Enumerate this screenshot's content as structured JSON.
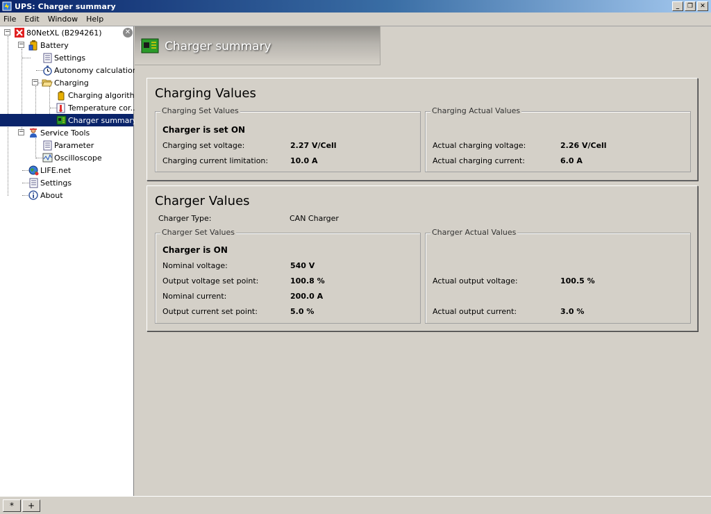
{
  "window": {
    "title": "UPS: Charger summary",
    "minimize_glyph": "_",
    "restore_glyph": "❐",
    "close_glyph": "✕"
  },
  "menu": [
    "File",
    "Edit",
    "Window",
    "Help"
  ],
  "tree": {
    "close_glyph": "✕",
    "items": [
      {
        "label": "80NetXL (B294261)",
        "icon": "ups-error-icon"
      },
      {
        "label": "Battery",
        "icon": "battery-icon"
      },
      {
        "label": "Settings",
        "icon": "settings-page-icon"
      },
      {
        "label": "Autonomy calculation",
        "icon": "stopwatch-icon"
      },
      {
        "label": "Charging",
        "icon": "folder-open-icon"
      },
      {
        "label": "Charging algorithm",
        "icon": "battery-small-icon"
      },
      {
        "label": "Temperature cor...",
        "icon": "thermometer-page-icon"
      },
      {
        "label": "Charger summary",
        "icon": "charger-board-icon"
      },
      {
        "label": "Service Tools",
        "icon": "service-person-icon"
      },
      {
        "label": "Parameter",
        "icon": "parameter-page-icon"
      },
      {
        "label": "Oscilloscope",
        "icon": "oscilloscope-icon"
      },
      {
        "label": "LIFE.net",
        "icon": "globe-icon"
      },
      {
        "label": "Settings",
        "icon": "settings-page-icon"
      },
      {
        "label": "About",
        "icon": "info-icon"
      }
    ]
  },
  "header": {
    "title": "Charger summary",
    "icon": "charger-board-icon"
  },
  "charging_values": {
    "title": "Charging Values",
    "set": {
      "legend": "Charging Set Values",
      "status": "Charger is set ON",
      "voltage_label": "Charging set voltage:",
      "voltage_value": "2.27 V/Cell",
      "current_label": "Charging current limitation:",
      "current_value": "10.0 A"
    },
    "actual": {
      "legend": "Charging Actual Values",
      "voltage_label": "Actual charging voltage:",
      "voltage_value": "2.26 V/Cell",
      "current_label": "Actual charging current:",
      "current_value": "6.0 A"
    }
  },
  "charger_values": {
    "title": "Charger Values",
    "type_label": "Charger Type:",
    "type_value": "CAN Charger",
    "set": {
      "legend": "Charger Set Values",
      "status": "Charger is ON",
      "nominal_voltage_label": "Nominal voltage:",
      "nominal_voltage_value": "540 V",
      "output_voltage_label": "Output voltage set point:",
      "output_voltage_value": "100.8 %",
      "nominal_current_label": "Nominal current:",
      "nominal_current_value": "200.0 A",
      "output_current_label": "Output current set point:",
      "output_current_value": "5.0 %"
    },
    "actual": {
      "legend": "Charger Actual Values",
      "output_voltage_label": "Actual output voltage:",
      "output_voltage_value": "100.5 %",
      "output_current_label": "Actual output current:",
      "output_current_value": "3.0 %"
    }
  },
  "statusbar": {
    "btn1": "*",
    "btn2": "+"
  }
}
